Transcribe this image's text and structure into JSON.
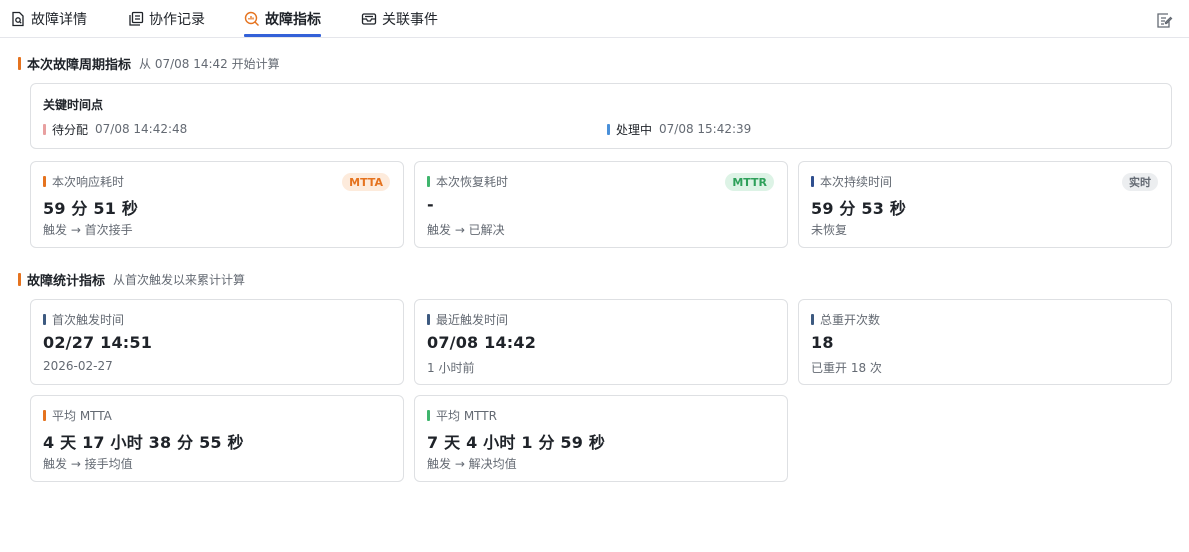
{
  "tabs": [
    {
      "label": "故障详情",
      "icon": "file-search-icon"
    },
    {
      "label": "协作记录",
      "icon": "copy-icon"
    },
    {
      "label": "故障指标",
      "icon": "chart-search-icon"
    },
    {
      "label": "关联事件",
      "icon": "inbox-icon"
    }
  ],
  "active_tab": "故障指标",
  "cycle": {
    "title": "本次故障周期指标",
    "subtitle": "从 07/08 14:42 开始计算",
    "key_times": {
      "title": "关键时间点",
      "items": [
        {
          "name": "待分配",
          "time": "07/08 14:42:48",
          "color": "#e8a0a0"
        },
        {
          "name": "处理中",
          "time": "07/08 15:42:39",
          "color": "#4a90d9"
        }
      ]
    },
    "cards": [
      {
        "label": "本次响应耗时",
        "badge": "MTTA",
        "value": "59 分 51 秒",
        "note": "触发 → 首次接手",
        "color": "#e5731f"
      },
      {
        "label": "本次恢复耗时",
        "badge": "MTTR",
        "value": "-",
        "note": "触发 → 已解决",
        "color": "#3fb56d"
      },
      {
        "label": "本次持续时间",
        "badge": "实时",
        "value": "59 分 53 秒",
        "note": "未恢复",
        "color": "#2f4f8f"
      }
    ]
  },
  "stats": {
    "title": "故障统计指标",
    "subtitle": "从首次触发以来累计计算",
    "cards": [
      {
        "label": "首次触发时间",
        "value": "02/27 14:51",
        "note": "2026-02-27",
        "color": "#3d5a80"
      },
      {
        "label": "最近触发时间",
        "value": "07/08 14:42",
        "note": "1 小时前",
        "color": "#3d5a80"
      },
      {
        "label": "总重开次数",
        "value": "18",
        "note": "已重开 18 次",
        "color": "#3d5a80"
      },
      {
        "label": "平均 MTTA",
        "value": "4 天 17 小时 38 分 55 秒",
        "note": "触发 → 接手均值",
        "color": "#e5731f"
      },
      {
        "label": "平均 MTTR",
        "value": "7 天 4 小时 1 分 59 秒",
        "note": "触发 → 解决均值",
        "color": "#3fb56d"
      }
    ]
  },
  "colors": {
    "accent": "#3361d8",
    "section_bar": "#e5731f"
  }
}
